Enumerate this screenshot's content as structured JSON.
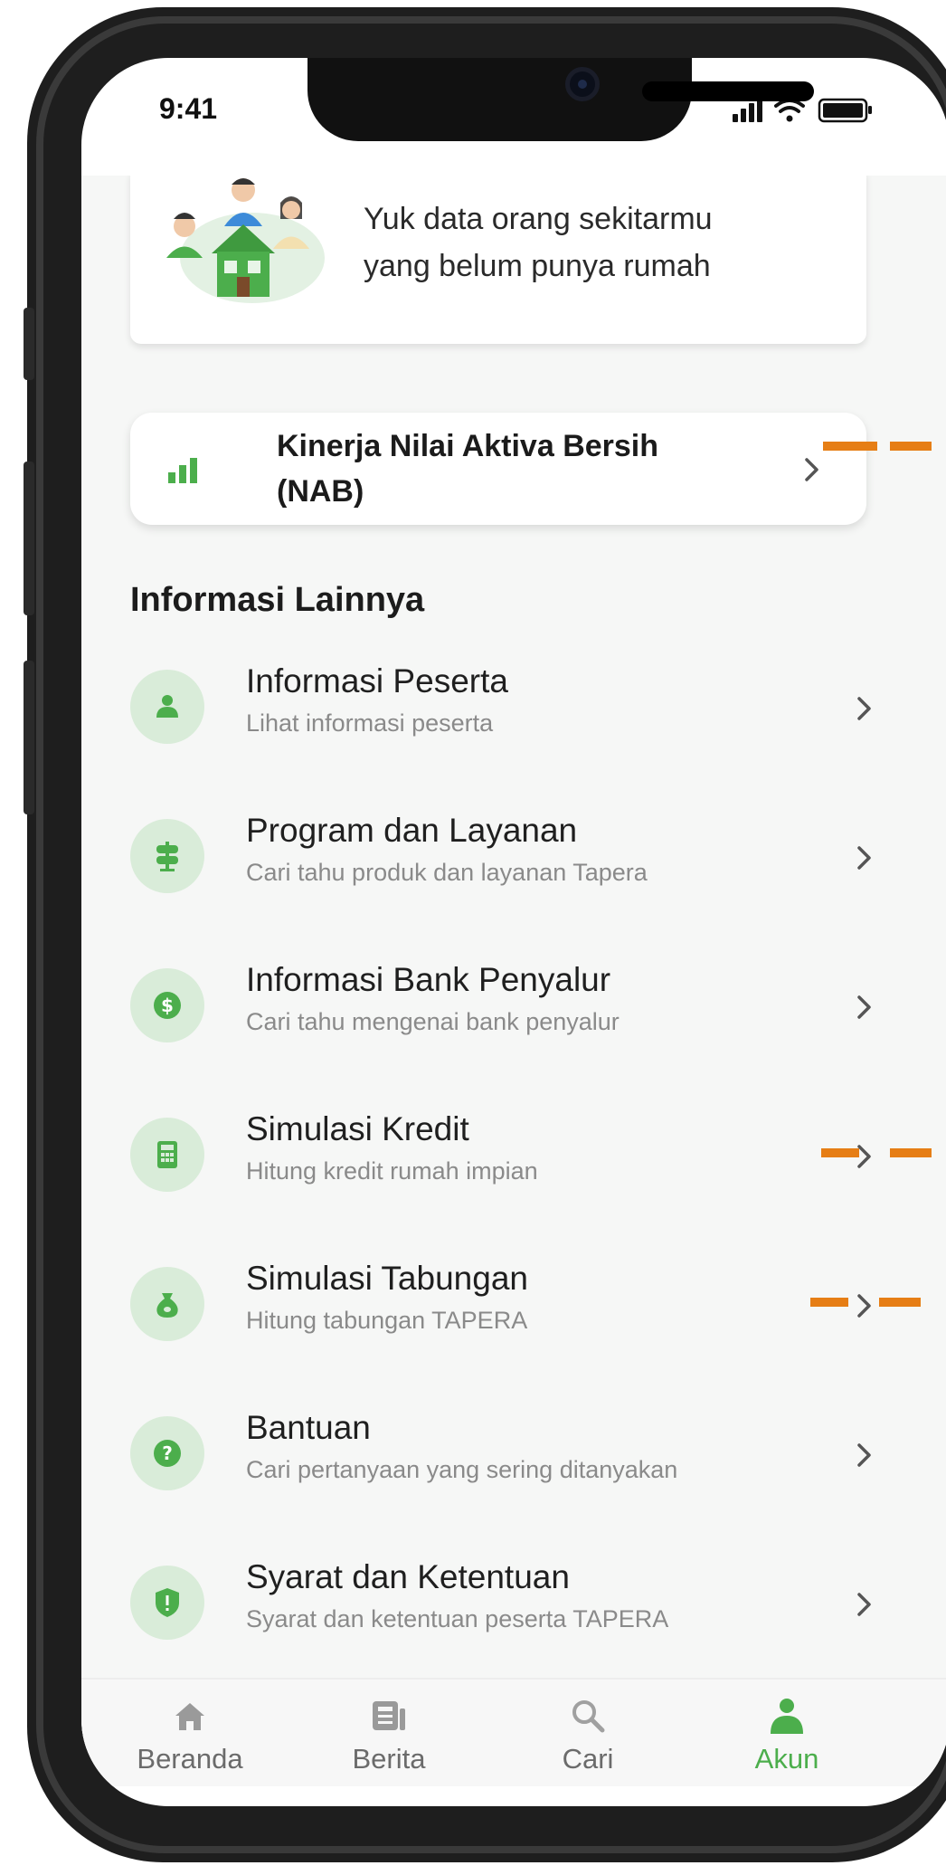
{
  "status_bar": {
    "time": "9:41"
  },
  "banner": {
    "line1": "Yuk data orang sekitarmu",
    "line2": "yang belum punya rumah"
  },
  "nab_card": {
    "line1": "Kinerja Nilai Aktiva Bersih",
    "line2": "(NAB)"
  },
  "section": {
    "title": "Informasi Lainnya"
  },
  "items": [
    {
      "title": "Informasi Peserta",
      "subtitle": "Lihat informasi peserta",
      "icon": "person-icon"
    },
    {
      "title": "Program dan Layanan",
      "subtitle": "Cari tahu produk dan layanan Tapera",
      "icon": "signpost-icon"
    },
    {
      "title": "Informasi Bank Penyalur",
      "subtitle": "Cari tahu mengenai bank penyalur",
      "icon": "dollar-icon"
    },
    {
      "title": "Simulasi Kredit",
      "subtitle": "Hitung kredit rumah impian",
      "icon": "calculator-icon"
    },
    {
      "title": "Simulasi Tabungan",
      "subtitle": "Hitung tabungan TAPERA",
      "icon": "money-bag-icon"
    },
    {
      "title": "Bantuan",
      "subtitle": "Cari pertanyaan yang sering ditanyakan",
      "icon": "help-icon"
    },
    {
      "title": "Syarat dan Ketentuan",
      "subtitle": "Syarat dan ketentuan peserta TAPERA",
      "icon": "shield-icon"
    }
  ],
  "nav": {
    "home": "Beranda",
    "news": "Berita",
    "search": "Cari",
    "account": "Akun"
  },
  "colors": {
    "accent": "#4cae4c",
    "icon_bg": "#d9ecd9",
    "annotation": "#e67e15"
  }
}
